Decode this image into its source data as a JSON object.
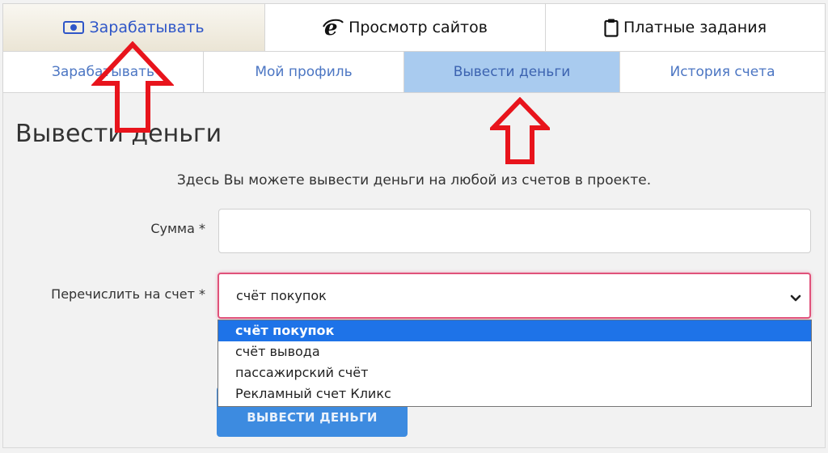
{
  "top_tabs": [
    {
      "label": "Зарабатывать",
      "icon": "money-icon"
    },
    {
      "label": "Просмотр сайтов",
      "icon": "internet-explorer-icon"
    },
    {
      "label": "Платные задания",
      "icon": "clipboard-icon"
    }
  ],
  "sub_tabs": [
    {
      "label": "Зарабатывать"
    },
    {
      "label": "Мой профиль"
    },
    {
      "label": "Вывести деньги",
      "active": true
    },
    {
      "label": "История счета"
    }
  ],
  "page_title": "Вывести деньги",
  "intro_text": "Здесь Вы можете вывести деньги на любой из счетов в проекте.",
  "form": {
    "amount_label": "Сумма *",
    "amount_value": "",
    "account_label": "Перечислить на счет *",
    "account_selected": "счёт покупок",
    "account_options": [
      "счёт покупок",
      "счёт вывода",
      "пассажирский счёт",
      "Рекламный счет Кликс"
    ],
    "submit_label": "ВЫВЕСТИ ДЕНЬГИ"
  },
  "colors": {
    "active_subtab_bg": "#a9cbef",
    "link_blue": "#4c76c3",
    "select_border": "#e0527a",
    "option_highlight": "#1e73e8",
    "button_blue": "#3d8be0",
    "annotation_arrow": "#e8141c"
  }
}
